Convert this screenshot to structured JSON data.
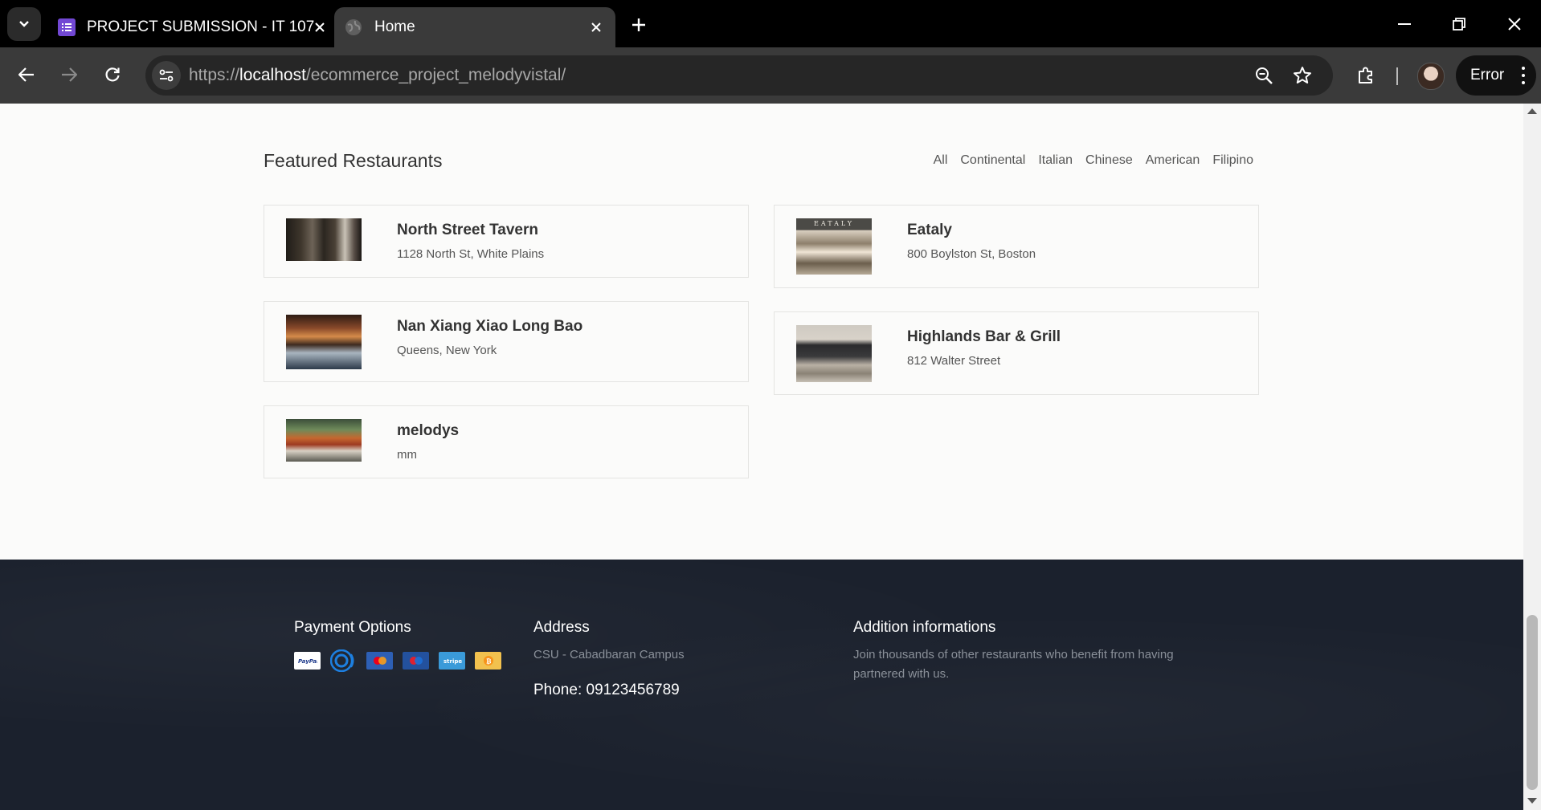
{
  "browser": {
    "tabs": [
      {
        "title": "PROJECT SUBMISSION - IT 107",
        "active": false
      },
      {
        "title": "Home",
        "active": true
      }
    ],
    "url_scheme": "https://",
    "url_host": "localhost",
    "url_path": "/ecommerce_project_melodyvistal/",
    "profile_button": "Error",
    "colors": {
      "tab_accent": "#7248d4",
      "chrome_bg": "#000000",
      "toolbar_bg": "#3a3a3a"
    }
  },
  "restaurants_section": {
    "title": "Featured Restaurants",
    "filters": [
      "All",
      "Continental",
      "Italian",
      "Chinese",
      "American",
      "Filipino"
    ],
    "restaurants": [
      {
        "name": "North Street Tavern",
        "address": "1128 North St, White Plains"
      },
      {
        "name": "Eataly",
        "address": "800 Boylston St, Boston",
        "image_sign": "EATALY"
      },
      {
        "name": "Nan Xiang Xiao Long Bao",
        "address": "Queens, New York"
      },
      {
        "name": "Highlands Bar & Grill",
        "address": "812 Walter Street"
      },
      {
        "name": "melodys",
        "address": "mm"
      }
    ]
  },
  "footer": {
    "payment": {
      "title": "Payment Options",
      "methods": [
        "PayPal",
        "Coins",
        "Mastercard",
        "Maestro",
        "stripe",
        "Bitcoin"
      ]
    },
    "address": {
      "title": "Address",
      "line": "CSU - Cabadbaran Campus",
      "phone": "Phone: 09123456789"
    },
    "info": {
      "title": "Addition informations",
      "text": "Join thousands of other restaurants who benefit from having partnered with us."
    },
    "colors": {
      "background": "#1b212d"
    }
  }
}
